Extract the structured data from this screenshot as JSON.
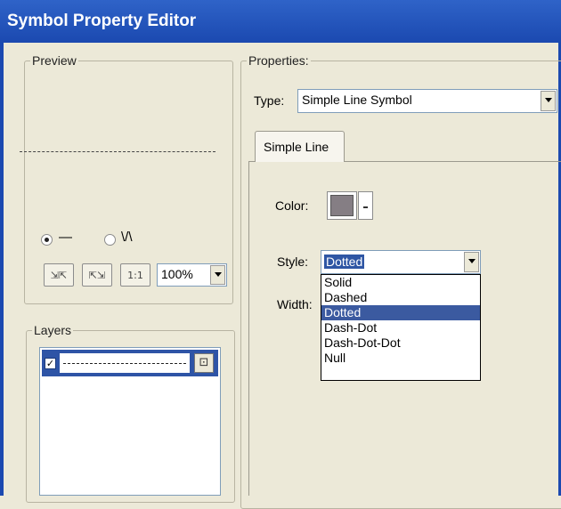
{
  "window": {
    "title": "Symbol Property Editor"
  },
  "preview": {
    "legend": "Preview",
    "radio_line_label": "—",
    "radio_fill_label": "\\/\\",
    "zoom_value": "100%",
    "buttons": [
      "zoom-in",
      "zoom-out",
      "actual-size"
    ]
  },
  "layers": {
    "legend": "Layers"
  },
  "properties": {
    "legend": "Properties:",
    "type_label": "Type:",
    "type_value": "Simple Line Symbol",
    "tab_label": "Simple Line",
    "color_label": "Color:",
    "color_value": "#857e84",
    "style_label": "Style:",
    "style_value": "Dotted",
    "width_label": "Width:",
    "style_options": [
      "Solid",
      "Dashed",
      "Dotted",
      "Dash-Dot",
      "Dash-Dot-Dot",
      "Null"
    ],
    "style_selected": "Dotted"
  }
}
